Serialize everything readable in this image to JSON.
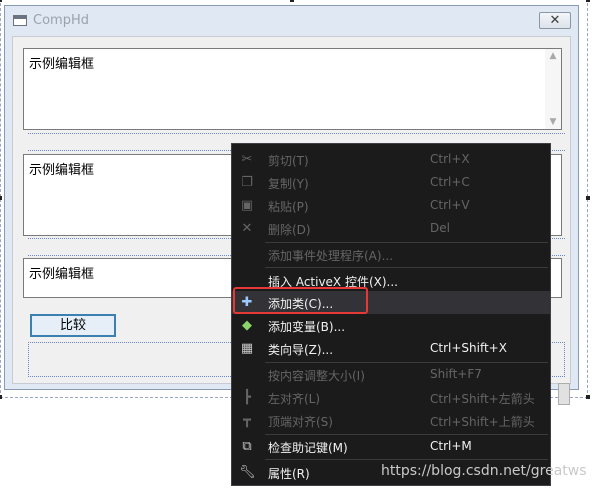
{
  "dialog": {
    "title": "CompHd",
    "close_icon": "✕",
    "edit1_text": "示例编辑框",
    "edit2_text": "示例编辑框",
    "edit3_text": "示例编辑框",
    "compare_label": "比较"
  },
  "menu": {
    "items": [
      {
        "label": "剪切(T)",
        "shortcut": "Ctrl+X",
        "icon": "cut-icon",
        "enabled": false
      },
      {
        "label": "复制(Y)",
        "shortcut": "Ctrl+C",
        "icon": "copy-icon",
        "enabled": false
      },
      {
        "label": "粘贴(P)",
        "shortcut": "Ctrl+V",
        "icon": "paste-icon",
        "enabled": false
      },
      {
        "label": "删除(D)",
        "shortcut": "Del",
        "icon": "delete-icon",
        "enabled": false
      },
      {
        "label": "添加事件处理程序(A)...",
        "shortcut": "",
        "icon": "",
        "enabled": false
      },
      {
        "label": "插入 ActiveX 控件(X)...",
        "shortcut": "",
        "icon": "",
        "enabled": true
      },
      {
        "label": "添加类(C)...",
        "shortcut": "",
        "icon": "add-class-icon",
        "enabled": true
      },
      {
        "label": "添加变量(B)...",
        "shortcut": "",
        "icon": "add-variable-icon",
        "enabled": true
      },
      {
        "label": "类向导(Z)...",
        "shortcut": "Ctrl+Shift+X",
        "icon": "class-wizard-icon",
        "enabled": true
      },
      {
        "label": "按内容调整大小(I)",
        "shortcut": "Shift+F7",
        "icon": "",
        "enabled": false
      },
      {
        "label": "左对齐(L)",
        "shortcut": "Ctrl+Shift+左箭头",
        "icon": "align-left-icon",
        "enabled": false
      },
      {
        "label": "顶端对齐(S)",
        "shortcut": "Ctrl+Shift+上箭头",
        "icon": "align-top-icon",
        "enabled": false
      },
      {
        "label": "检查助记键(M)",
        "shortcut": "Ctrl+M",
        "icon": "check-mnemonics-icon",
        "enabled": true
      },
      {
        "label": "属性(R)",
        "shortcut": "",
        "icon": "properties-icon",
        "enabled": true
      }
    ]
  },
  "watermark": "https://blog.csdn.net/greatws"
}
